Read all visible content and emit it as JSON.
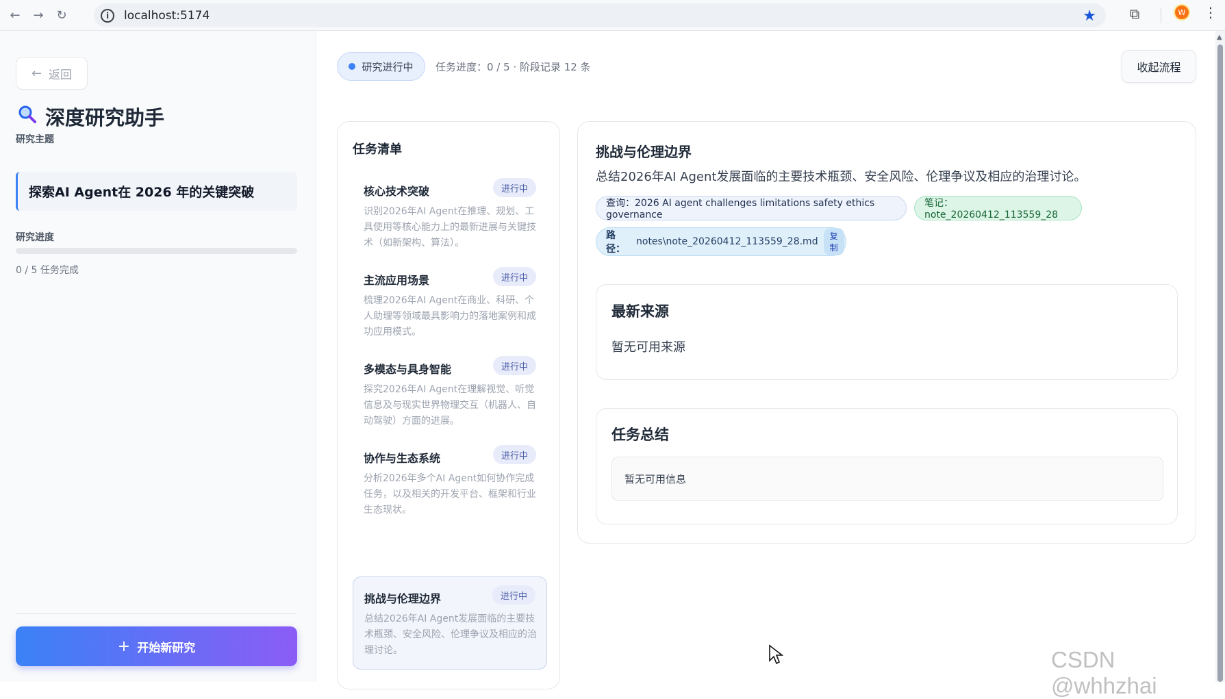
{
  "browser": {
    "url": "localhost:5174"
  },
  "sidebar": {
    "back_label": "返回",
    "app_title": "深度研究助手",
    "topic_label": "研究主题",
    "topic_value": "探索AI Agent在 2026 年的关键突破",
    "progress_label": "研究进度",
    "progress_fraction": 0,
    "progress_text": "0 / 5 任务完成",
    "start_button": "开始新研究"
  },
  "header": {
    "status": "研究进行中",
    "meta": "任务进度：0 / 5 · 阶段记录 12 条",
    "collapse_button": "收起流程"
  },
  "task_list": {
    "title": "任务清单",
    "items": [
      {
        "name": "核心技术突破",
        "status": "进行中",
        "desc": "识别2026年AI Agent在推理、规划、工具使用等核心能力上的最新进展与关键技术（如新架构、算法）。"
      },
      {
        "name": "主流应用场景",
        "status": "进行中",
        "desc": "梳理2026年AI Agent在商业、科研、个人助理等领域最具影响力的落地案例和成功应用模式。"
      },
      {
        "name": "多模态与具身智能",
        "status": "进行中",
        "desc": "探究2026年AI Agent在理解视觉、听觉信息及与现实世界物理交互（机器人、自动驾驶）方面的进展。"
      },
      {
        "name": "协作与生态系统",
        "status": "进行中",
        "desc": "分析2026年多个AI Agent如何协作完成任务，以及相关的开发平台、框架和行业生态现状。"
      },
      {
        "name": "挑战与伦理边界",
        "status": "进行中",
        "desc": "总结2026年AI Agent发展面临的主要技术瓶颈、安全风险、伦理争议及相应的治理讨论。"
      }
    ]
  },
  "detail": {
    "title": "挑战与伦理边界",
    "desc": "总结2026年AI Agent发展面临的主要技术瓶颈、安全风险、伦理争议及相应的治理讨论。",
    "query_chip": "查询：2026 AI agent challenges limitations safety ethics governance",
    "note_chip": "笔记：note_20260412_113559_28",
    "path_label": "路径：",
    "path_value": "notes\\note_20260412_113559_28.md",
    "copy_label": "复制",
    "sources_title": "最新来源",
    "sources_empty": "暂无可用来源",
    "summary_title": "任务总结",
    "summary_empty": "暂无可用信息"
  },
  "watermark": "CSDN @whhzhai"
}
